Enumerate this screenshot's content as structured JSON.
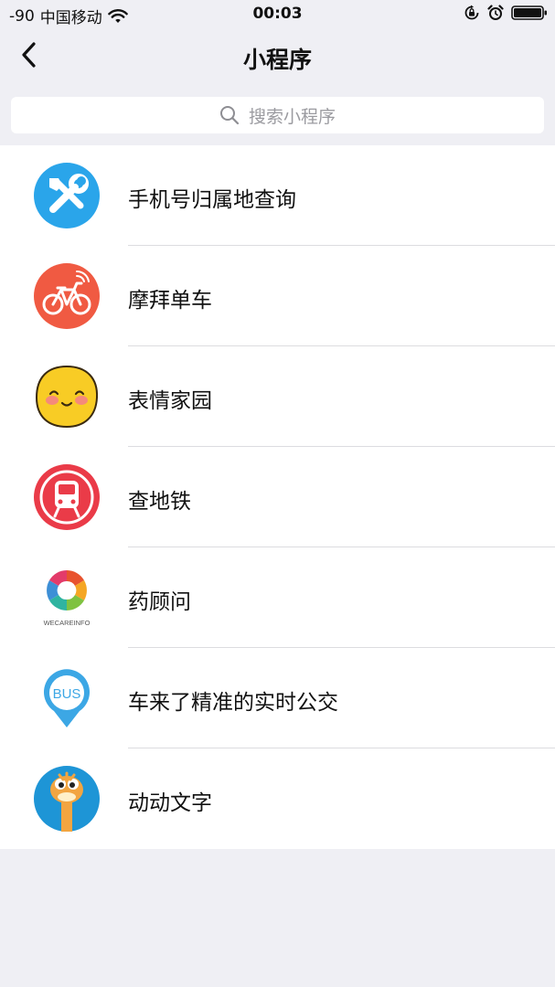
{
  "status_bar": {
    "signal": "-90",
    "carrier": "中国移动",
    "time": "00:03"
  },
  "nav": {
    "title": "小程序"
  },
  "search": {
    "placeholder": "搜索小程序"
  },
  "items": [
    {
      "label": "手机号归属地查询",
      "icon": "tools-icon",
      "color": "#2aa5ea"
    },
    {
      "label": "摩拜单车",
      "icon": "bicycle-icon",
      "color": "#f05a42"
    },
    {
      "label": "表情家园",
      "icon": "smiley-face-icon",
      "color": "#f8cc25"
    },
    {
      "label": "查地铁",
      "icon": "subway-icon",
      "color": "#ea3b48"
    },
    {
      "label": "药顾问",
      "icon": "wecareinfo-logo-icon",
      "logo_text": "WECAREINFO",
      "color": "#e8532e"
    },
    {
      "label": "车来了精准的实时公交",
      "icon": "bus-pin-icon",
      "logo_text": "BUS",
      "color": "#3ca7e5"
    },
    {
      "label": "动动文字",
      "icon": "ostrich-icon",
      "color": "#1e95d6"
    }
  ]
}
